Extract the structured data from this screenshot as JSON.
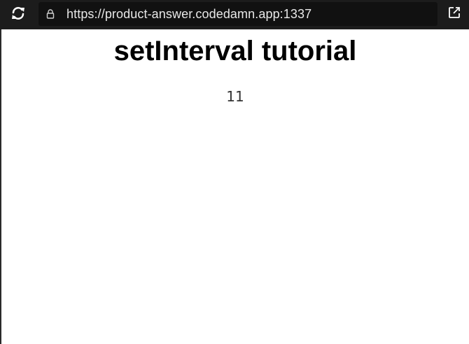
{
  "browser": {
    "url": "https://product-answer.codedamn.app:1337",
    "icons": {
      "reload": "reload-icon",
      "lock": "lock-icon",
      "external": "external-link-icon"
    },
    "colors": {
      "bar_background": "#1c1c1c",
      "address_background": "#111111",
      "url_text": "#e8e8e8"
    }
  },
  "page": {
    "title": "setInterval tutorial",
    "counter_value": "11"
  }
}
